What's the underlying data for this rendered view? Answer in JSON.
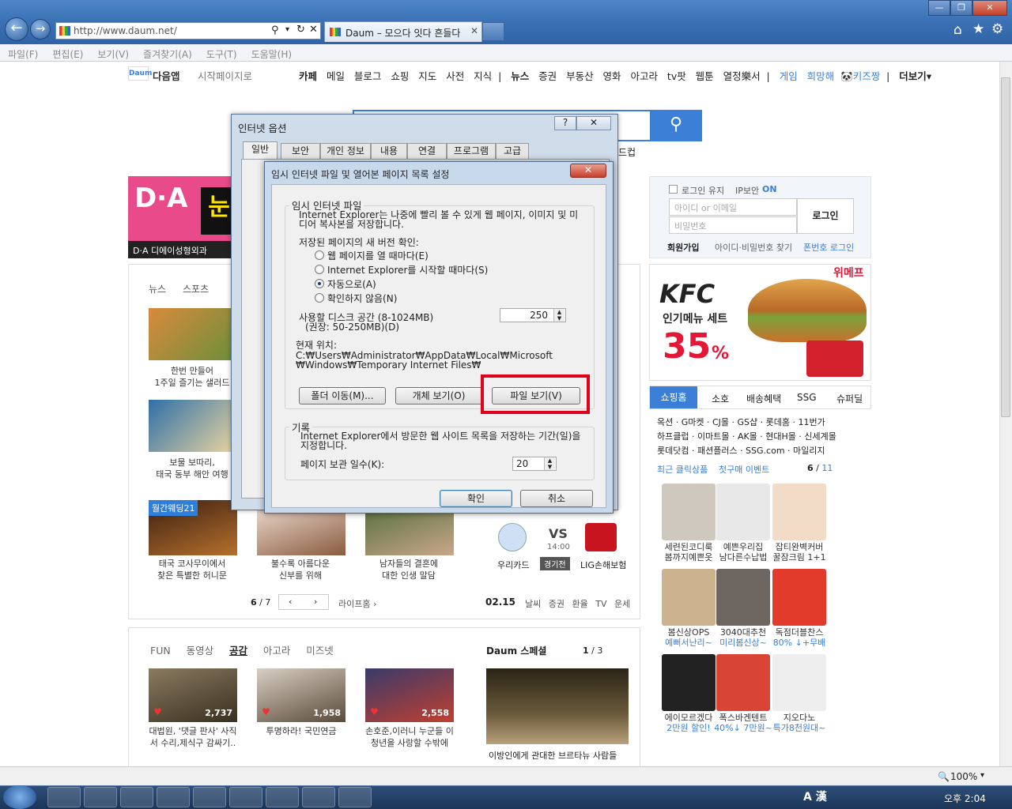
{
  "browser": {
    "url": "http://www.daum.net/",
    "tab_title": "Daum – 모으다 잇다 흔들다",
    "menu": [
      "파일(F)",
      "편집(E)",
      "보기(V)",
      "즐겨찾기(A)",
      "도구(T)",
      "도움말(H)"
    ],
    "zoom": "100%"
  },
  "daum": {
    "app_label": "다음앱",
    "startpage": "시작페이지로",
    "nav": [
      "카페",
      "메일",
      "블로그",
      "쇼핑",
      "지도",
      "사전",
      "지식",
      "뉴스",
      "증권",
      "부동산",
      "영화",
      "아고라",
      "tv팟",
      "웹툰",
      "열정樂서",
      "게임",
      "희망해",
      "키즈짱",
      "더보기"
    ],
    "login": {
      "keep": "로그인 유지",
      "ip": "IP보안",
      "ip_state": "ON",
      "id_placeholder": "아이디 or 이메일",
      "pw_placeholder": "비밀번호",
      "button": "로그인",
      "join": "회원가입",
      "find": "아이디·비밀번호 찾기",
      "phone": "폰번호 로그인"
    },
    "ad_kfc": {
      "brand": "KFC",
      "sub": "인기메뉴 세트",
      "pct": "35",
      "pct_unit": "%",
      "corner": "위메프"
    },
    "da_label": "D·A 디에이성형외과",
    "shopping_tabs": [
      "쇼핑홈",
      "소호",
      "배송혜택",
      "SSG",
      "슈퍼딜"
    ],
    "shop_links": [
      "옥션 · G마켓 · CJ몰 · GS샵 · 롯데홈 · 11번가",
      "하프클럽 · 이마트몰 · AK몰 · 현대H몰 · 신세계몰",
      "롯데닷컴 · 패션플러스 · SSG.com · 마일리지"
    ],
    "shop_recent": "최근 클릭상품",
    "shop_first": "첫구매 이벤트",
    "shop_page": "6",
    "shop_total": "11",
    "shop_items": [
      {
        "t1": "세련된코디룩",
        "t2": "봄까지예쁜옷"
      },
      {
        "t1": "예쁜우리집",
        "t2": "남다른수납법"
      },
      {
        "t1": "잡티완벽커버",
        "t2": "꿀잠크림 1+1"
      },
      {
        "t1": "봄신상OPS",
        "t2": "예뻐서난리~"
      },
      {
        "t1": "3040대추천",
        "t2": "미리봄신상~"
      },
      {
        "t1": "독점더블찬스",
        "t2": "80% ↓+무배"
      },
      {
        "t1": "에이모르겠다",
        "t2": "2만원 할인!"
      },
      {
        "t1": "폭스바겐텐트",
        "t2": "40%↓ 7만원~"
      },
      {
        "t1": "지오다노",
        "t2": "특가8천원대~"
      }
    ],
    "news_tabs": [
      "뉴스",
      "스포츠"
    ],
    "life_items": [
      {
        "t1": "한번 만들어",
        "t2": "1주일 즐기는 샐러드"
      },
      {
        "t1": "보물 보따리,",
        "t2": "태국 동부 해안 여행"
      }
    ],
    "wedding": {
      "badge": "월간웨딩21",
      "items": [
        {
          "t1": "태국 코사무이에서",
          "t2": "찾은 특별한 허니문"
        },
        {
          "t1": "불수록 아름다운",
          "t2": "신부를 위해"
        },
        {
          "t1": "남자들의 결혼에",
          "t2": "대한 인생 말담"
        }
      ]
    },
    "life_page": "6",
    "life_total": "7",
    "life_home": "라이프홈 ›",
    "sports": {
      "team1": "우리카드",
      "team2": "LIG손해보험",
      "vs": "VS",
      "time": "14:00",
      "state": "경기전"
    },
    "date": "02.15",
    "quick": [
      "날씨",
      "증권",
      "환율",
      "TV",
      "운세"
    ],
    "fun_tabs": [
      "FUN",
      "동영상",
      "공감",
      "아고라",
      "미즈넷"
    ],
    "fun_items": [
      {
        "likes": "2,737",
        "t1": "대법원, '댓글 판사' 사직",
        "t2": "서 수리,제식구 감싸기.."
      },
      {
        "likes": "1,958",
        "t1": "투명하라! 국민연금",
        "t2": ""
      },
      {
        "likes": "2,558",
        "t1": "손호준,이러니 누군들 이",
        "t2": "청년을 사랑할 수밖에"
      }
    ],
    "special": {
      "title": "Daum 스페셜",
      "page": "1",
      "total": "3",
      "caption": "이방인에게 관대한 브르타뉴 사람들"
    }
  },
  "dialog_options": {
    "title": "인터넷 옵션",
    "tabs": [
      "일반",
      "보안",
      "개인 정보",
      "내용",
      "연결",
      "프로그램",
      "고급"
    ]
  },
  "dialog_temp": {
    "title": "임시 인터넷 파일 및 열어본 페이지 목록 설정",
    "group1": "임시 인터넷 파일",
    "desc1": "Internet Explorer는 나중에 빨리 볼 수 있게 웹 페이지, 이미지 및 미디어 복사본을 저장합니다.",
    "check_label": "저장된 페이지의 새 버전 확인:",
    "radios": [
      "웹 페이지를 열 때마다(E)",
      "Internet Explorer를 시작할 때마다(S)",
      "자동으로(A)",
      "확인하지 않음(N)"
    ],
    "selected": 2,
    "disk_label": "사용할 디스크 공간 (8-1024MB)",
    "disk_hint": "(권장: 50-250MB)(D)",
    "disk_value": "250",
    "location_label": "현재 위치:",
    "location_path": "C:₩Users₩Administrator₩AppData₩Local₩Microsoft₩Windows₩Temporary Internet Files₩",
    "btn_move": "폴더 이동(M)...",
    "btn_objects": "개체 보기(O)",
    "btn_files": "파일 보기(V)",
    "group2": "기록",
    "desc2": "Internet Explorer에서 방문한 웹 사이트 목록을 저장하는 기간(일)을 지정합니다.",
    "days_label": "페이지 보관 일수(K):",
    "days_value": "20",
    "ok": "확인",
    "cancel": "취소"
  },
  "taskbar": {
    "time": "오후 2:04",
    "ime": "A 漢"
  },
  "colors": {
    "highlight": "#e0001b",
    "daum_blue": "#3b7fd6",
    "kfc_red": "#e31837"
  }
}
